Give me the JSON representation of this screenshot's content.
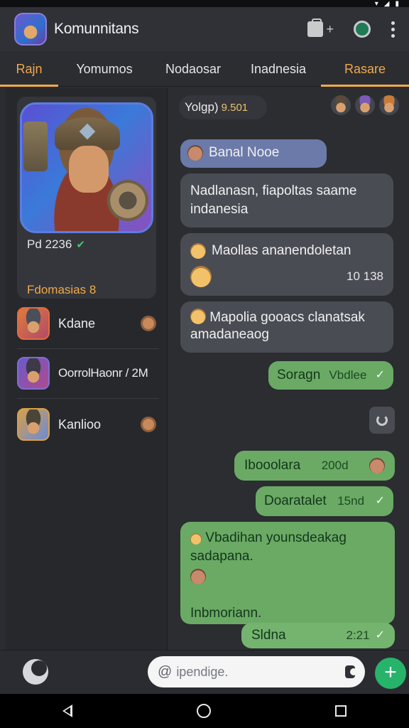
{
  "app": {
    "title": "Komunnitans"
  },
  "tabs": [
    {
      "label": "Rajn",
      "active": true
    },
    {
      "label": "Yomumos"
    },
    {
      "label": "Nodaosar"
    },
    {
      "label": "Inadnesia"
    },
    {
      "label": "Rasare",
      "active": true
    }
  ],
  "profile": {
    "stat": "Pd 2236",
    "subtitle": "Fdomasias 8"
  },
  "contacts": [
    {
      "name": "Kdane"
    },
    {
      "name": "OorrolHaonr / 2M"
    },
    {
      "name": "Kanlioo"
    }
  ],
  "chat": {
    "header": {
      "name": "Yolgp)",
      "count": "9.501"
    },
    "messages": [
      {
        "text": "Banal Nooe"
      },
      {
        "text": "Nadlanasn, fiapoltas saame indanesia"
      },
      {
        "text": "Maollas ananendoletan",
        "time": "10 138"
      },
      {
        "text": "Mapolia gooacs clanatsak amadaneaog"
      },
      {
        "text": "Soragn",
        "meta": "Vbdlee"
      },
      {
        "text": "Ibooolara",
        "meta": "200d"
      },
      {
        "text": "Doaratalet",
        "meta": "15nd"
      },
      {
        "text": "Vbadihan younsdeakag sadapana.",
        "extra": "Inbmoriann."
      },
      {
        "text": "Sldna",
        "time": "2:21"
      }
    ]
  },
  "composer": {
    "placeholder": "ipendige."
  },
  "icons": {
    "status": [
      "wifi-icon",
      "signal-icon",
      "battery-icon"
    ],
    "appbar": [
      "clipboard-icon",
      "chat-icon",
      "more-vert-icon"
    ],
    "composer": [
      "moon-icon",
      "search-icon",
      "camera-icon",
      "add-icon"
    ],
    "nav": [
      "back-icon",
      "home-icon",
      "recents-icon"
    ]
  },
  "colors": {
    "accent": "#f1a94a",
    "background": "#2a2c31",
    "bubble_grey": "#4a4c53",
    "bubble_green": "#6aaa65",
    "fab_green": "#27b36a"
  }
}
